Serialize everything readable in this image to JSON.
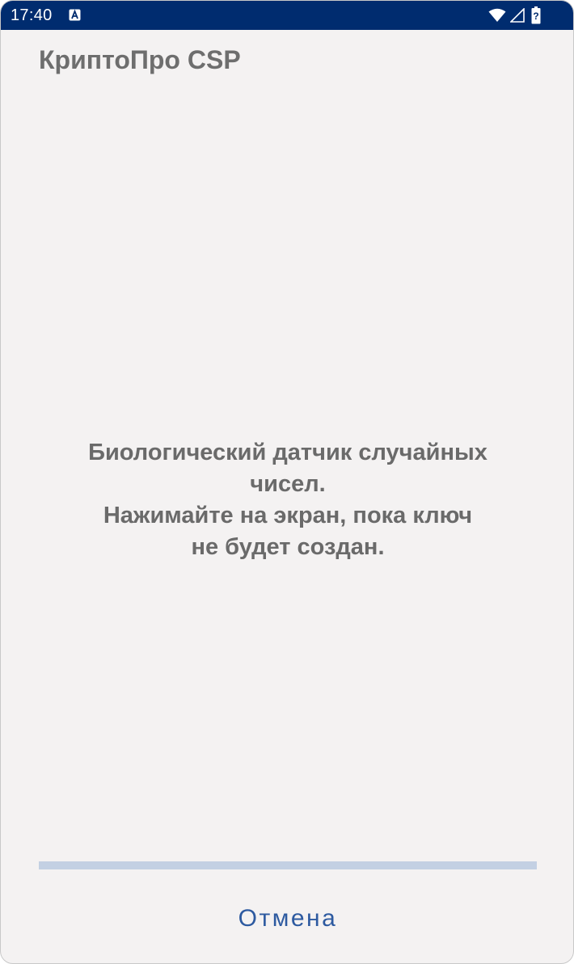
{
  "status_bar": {
    "time": "17:40",
    "notification_icon": "accessibility-notification-icon",
    "wifi_icon": "wifi-icon",
    "signal_icon": "cell-signal-icon",
    "battery_icon": "battery-unknown-icon",
    "battery_glyph": "?",
    "background_color": "#002c6f"
  },
  "app": {
    "title": "КриптоПро CSP"
  },
  "message": {
    "line1": "Биологический датчик случайных",
    "line2": "чисел.",
    "line3": "Нажимайте на экран, пока ключ",
    "line4": "не будет создан."
  },
  "progress": {
    "fraction": 0.0,
    "track_color": "#c3d0e3",
    "fill_color": "#2a5aa5"
  },
  "actions": {
    "cancel_label": "Отмена",
    "accent_color": "#2d5aa0"
  }
}
